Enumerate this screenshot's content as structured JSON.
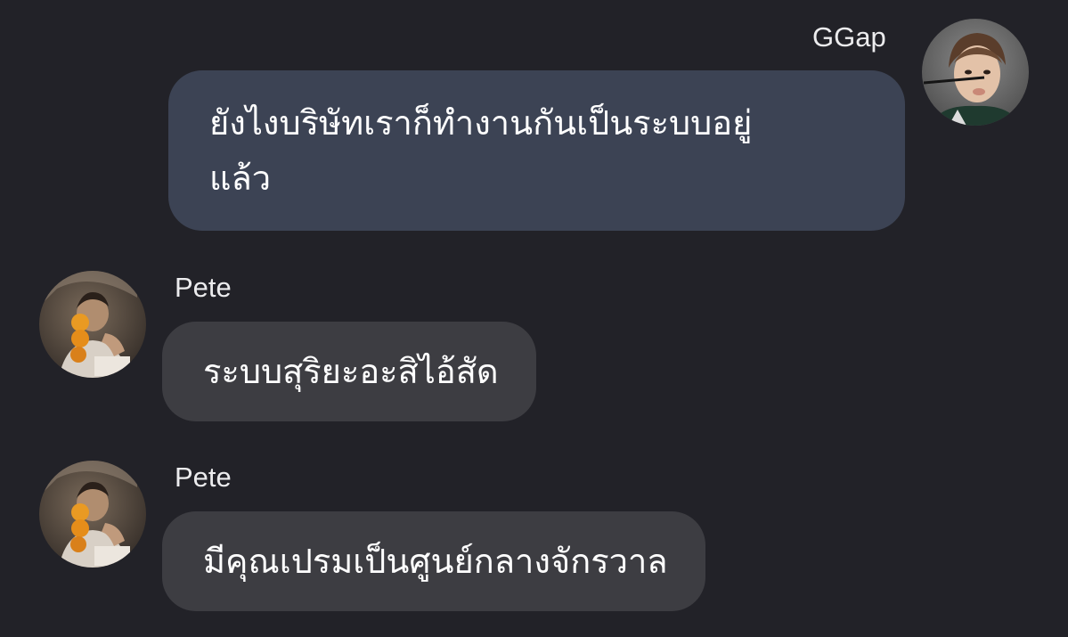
{
  "messages": [
    {
      "direction": "outgoing",
      "sender": "GGap",
      "avatar_icon": "user-avatar-icon",
      "lines": [
        "ยังไงบริษัทเราก็ทำงานกันเป็นระบบอยู่",
        "แล้ว"
      ]
    },
    {
      "direction": "incoming",
      "sender": "Pete",
      "avatar_icon": "user-avatar-icon",
      "text": "ระบบสุริยะอะสิไอ้สัด"
    },
    {
      "direction": "incoming",
      "sender": "Pete",
      "avatar_icon": "user-avatar-icon",
      "text": "มีคุณเปรมเป็นศูนย์กลางจักรวาล"
    }
  ],
  "colors": {
    "background": "#222228",
    "outgoing_bubble": "#3c4354",
    "incoming_bubble": "#3d3d42",
    "text": "#ffffff",
    "sender_name": "#ececee"
  }
}
